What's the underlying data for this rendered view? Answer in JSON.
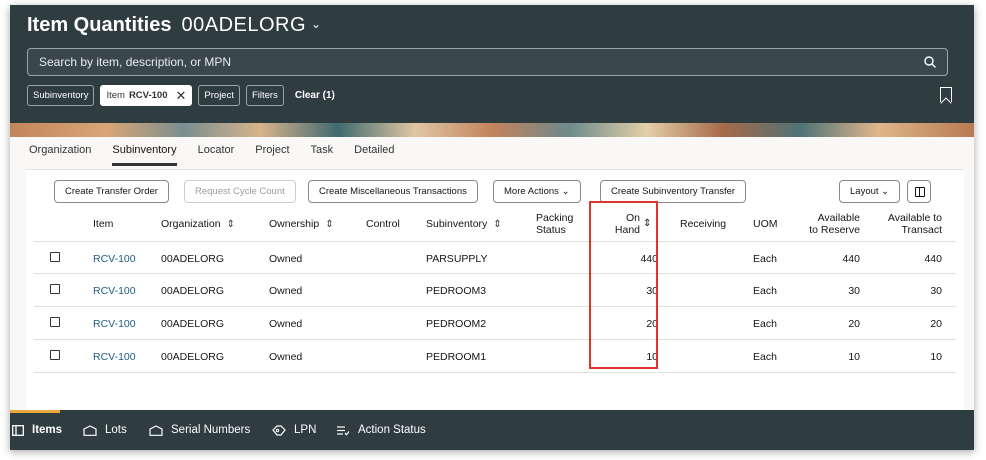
{
  "header": {
    "title": "Item Quantities",
    "org": "00ADELORG",
    "org_caret": "⌄",
    "search_placeholder": "Search by item, description, or MPN"
  },
  "chips": {
    "subinventory": "Subinventory",
    "item_prefix": "Item",
    "item_value": "RCV-100",
    "project": "Project",
    "filters": "Filters",
    "clear": "Clear (1)"
  },
  "tabs": [
    "Organization",
    "Subinventory",
    "Locator",
    "Project",
    "Task",
    "Detailed"
  ],
  "toolbar": {
    "create_transfer_order": "Create Transfer Order",
    "request_cycle_count": "Request Cycle Count",
    "create_misc_transactions": "Create Miscellaneous Transactions",
    "more_actions": "More Actions",
    "create_subinventory_transfer": "Create Subinventory Transfer",
    "layout": "Layout"
  },
  "columns": {
    "item": "Item",
    "organization": "Organization",
    "ownership": "Ownership",
    "control": "Control",
    "subinventory": "Subinventory",
    "packing_status_1": "Packing",
    "packing_status_2": "Status",
    "on_hand_1": "On",
    "on_hand_2": "Hand",
    "receiving": "Receiving",
    "uom": "UOM",
    "available_reserve_1": "Available",
    "available_reserve_2": "to Reserve",
    "available_transact_1": "Available to",
    "available_transact_2": "Transact"
  },
  "rows": [
    {
      "item": "RCV-100",
      "organization": "00ADELORG",
      "ownership": "Owned",
      "subinventory": "PARSUPPLY",
      "on_hand": "440",
      "uom": "Each",
      "available_reserve": "440",
      "available_transact": "440"
    },
    {
      "item": "RCV-100",
      "organization": "00ADELORG",
      "ownership": "Owned",
      "subinventory": "PEDROOM3",
      "on_hand": "30",
      "uom": "Each",
      "available_reserve": "30",
      "available_transact": "30"
    },
    {
      "item": "RCV-100",
      "organization": "00ADELORG",
      "ownership": "Owned",
      "subinventory": "PEDROOM2",
      "on_hand": "20",
      "uom": "Each",
      "available_reserve": "20",
      "available_transact": "20"
    },
    {
      "item": "RCV-100",
      "organization": "00ADELORG",
      "ownership": "Owned",
      "subinventory": "PEDROOM1",
      "on_hand": "10",
      "uom": "Each",
      "available_reserve": "10",
      "available_transact": "10"
    }
  ],
  "footer": {
    "items": "Items",
    "lots": "Lots",
    "serial_numbers": "Serial Numbers",
    "lpn": "LPN",
    "action_status": "Action Status"
  },
  "colors": {
    "header_bg": "#2f3c40",
    "link": "#1d5d85",
    "highlight": "#e0342b",
    "active_indicator": "#e8a93a"
  }
}
